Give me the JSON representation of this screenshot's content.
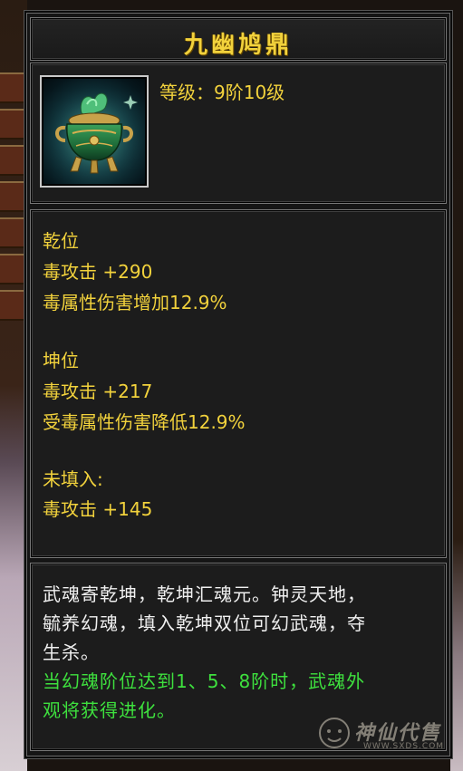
{
  "tooltip": {
    "title": "九幽鸠鼎",
    "level_text": "等级：9阶10级",
    "item_icon": "green-cauldron-icon",
    "stats": {
      "qian_header": "乾位",
      "qian_stat1": "毒攻击 +290",
      "qian_stat2": "毒属性伤害增加12.9%",
      "kun_header": "坤位",
      "kun_stat1": "毒攻击 +217",
      "kun_stat2": "受毒属性伤害降低12.9%",
      "unfilled_header": "未填入:",
      "unfilled_stat1": "毒攻击 +145"
    },
    "description": {
      "line1": "武魂寄乾坤，乾坤汇魂元。钟灵天地，",
      "line2": "毓养幻魂，填入乾坤双位可幻武魂，夺",
      "line3": "生杀。",
      "green_line1": "当幻魂阶位达到1、5、8阶时，武魂外",
      "green_line2": "观将获得进化。"
    }
  },
  "watermark": {
    "text": "神仙代售",
    "url": "WWW.SXDS.COM"
  },
  "colors": {
    "title_gold": "#f2d23c",
    "stat_gold": "#f2d23c",
    "desc_white": "#f0f0f0",
    "desc_green": "#3ee03e",
    "panel_bg": "#151515",
    "border_gray": "#777777"
  }
}
